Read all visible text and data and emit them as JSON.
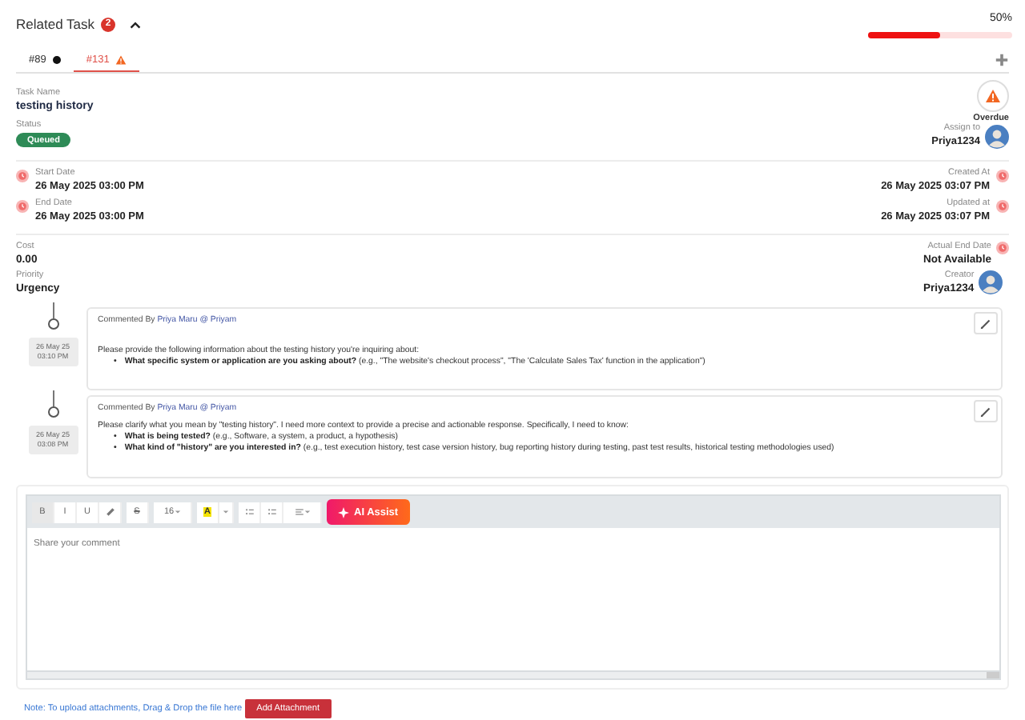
{
  "header": {
    "title": "Related Task",
    "count": "2",
    "expanded": true,
    "progress": {
      "label": "50%",
      "level": 0.5
    }
  },
  "tabs": [
    {
      "label": "#89",
      "kind": "dot",
      "selected": false
    },
    {
      "label": "#131",
      "kind": "warning",
      "selected": true
    }
  ],
  "task": {
    "name_label": "Task Name",
    "name": "testing history",
    "status_label": "Status",
    "status": "Queued",
    "alert": "Overdue",
    "assignee_label": "Assign to",
    "assignee": "Priya1234"
  },
  "dates": {
    "left": [
      {
        "label": "Start Date",
        "value": "26 May 2025 03:00 PM"
      },
      {
        "label": "End Date",
        "value": "26 May 2025 03:00 PM"
      }
    ],
    "right": [
      {
        "label": "Created At",
        "value": "26 May 2025 03:07 PM"
      },
      {
        "label": "Updated at",
        "value": "26 May 2025 03:07 PM"
      }
    ]
  },
  "info": {
    "left": [
      {
        "label": "Cost",
        "value": "0.00"
      },
      {
        "label": "Priority",
        "value": "Urgency"
      }
    ],
    "right": [
      {
        "label": "Actual End Date",
        "value": "Not Available",
        "kind": "clock"
      },
      {
        "label": "Creator",
        "value": "Priya1234",
        "kind": "avatar"
      }
    ]
  },
  "comments": [
    {
      "date": "26 May 25",
      "time": "03:10 PM",
      "prefix": "Commented By",
      "author": "Priya Maru @ Priyam",
      "text": "Please provide the following information about the testing history you're inquiring about:",
      "bullets": [
        {
          "marker": "•",
          "text": "**What specific system or application are you asking about?** (e.g., \"The website's checkout process\", \"The 'Calculate Sales Tax' function in the application\")"
        }
      ]
    },
    {
      "date": "26 May 25",
      "time": "03:08 PM",
      "prefix": "Commented By",
      "author": "Priya Maru @ Priyam",
      "text": "Please clarify what you mean by \"testing history\". I need more context to provide a precise and actionable response. Specifically, I need to know:",
      "bullets": [
        {
          "marker": "•",
          "text": "**What is being tested?** (e.g., Software, a system, a product, a hypothesis)"
        },
        {
          "marker": "•",
          "text": "**What kind of \"history\" are you interested in?** (e.g., test execution history, test case version history, bug reporting history during testing, past test results, historical testing methodologies used)"
        }
      ]
    }
  ],
  "editor": {
    "toolbar": {
      "bold": "B",
      "italic": "I",
      "underline": "U",
      "strike": "S",
      "font_size": "16",
      "highlight": "A"
    },
    "ai_button": "AI Assist",
    "placeholder": "Share your comment"
  },
  "footer": {
    "note": "Note: To upload attachments, Drag & Drop the file here",
    "button": "Add Attachment"
  }
}
